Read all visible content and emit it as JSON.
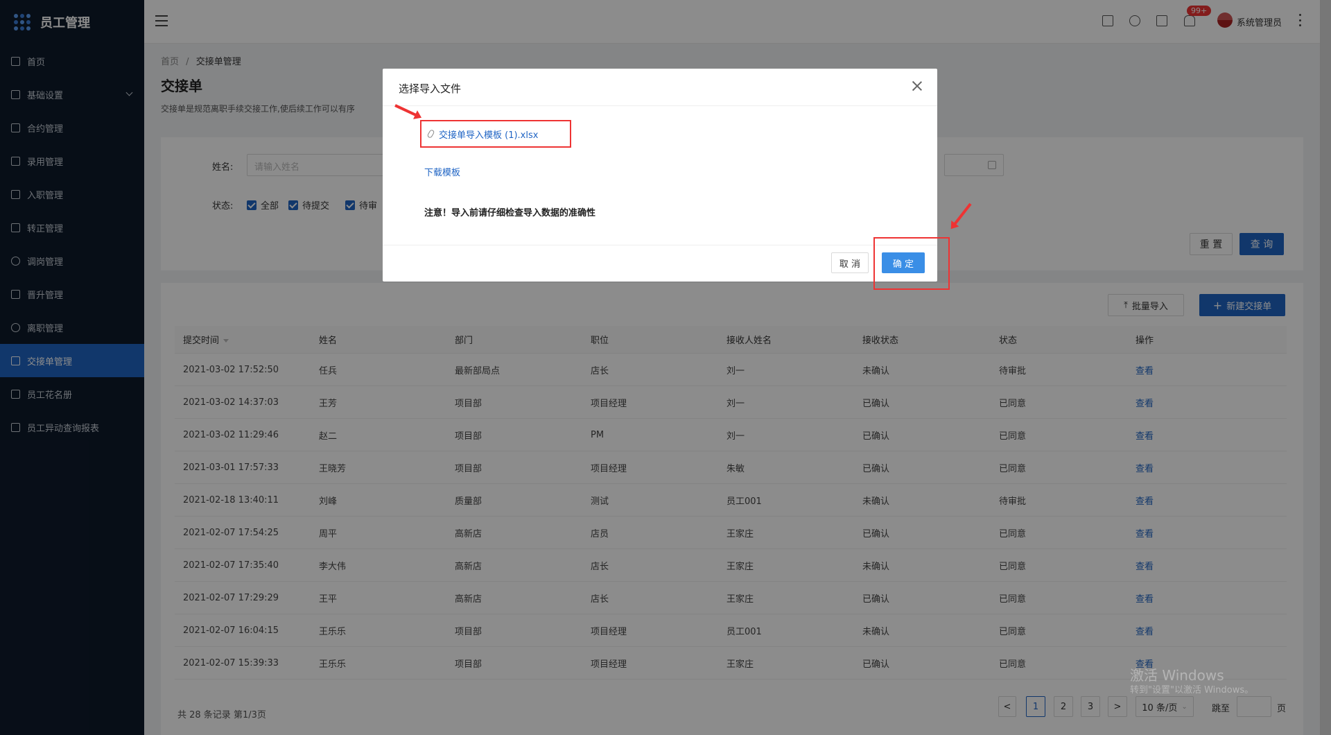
{
  "app": {
    "title": "员工管理"
  },
  "sidebar": {
    "items": [
      {
        "label": "首页"
      },
      {
        "label": "基础设置"
      },
      {
        "label": "合约管理"
      },
      {
        "label": "录用管理"
      },
      {
        "label": "入职管理"
      },
      {
        "label": "转正管理"
      },
      {
        "label": "调岗管理"
      },
      {
        "label": "晋升管理"
      },
      {
        "label": "离职管理"
      },
      {
        "label": "交接单管理"
      },
      {
        "label": "员工花名册"
      },
      {
        "label": "员工异动查询报表"
      }
    ]
  },
  "header": {
    "notification_badge": "99+",
    "username": "系统管理员"
  },
  "breadcrumb": {
    "home": "首页",
    "separator": "/",
    "current": "交接单管理"
  },
  "page": {
    "title": "交接单",
    "description": "交接单是规范离职手续交接工作,使后续工作可以有序"
  },
  "filter": {
    "name_label": "姓名:",
    "name_placeholder": "请输入姓名",
    "status_label": "状态:",
    "status_options": [
      "全部",
      "待提交",
      "待审"
    ],
    "reset_label": "重 置",
    "search_label": "查 询"
  },
  "toolbar": {
    "batch_import_label": "批量导入",
    "new_label": "新建交接单"
  },
  "table": {
    "headers": [
      "提交时间",
      "姓名",
      "部门",
      "职位",
      "接收人姓名",
      "接收状态",
      "状态",
      "操作"
    ],
    "rows": [
      [
        "2021-03-02 17:52:50",
        "任兵",
        "最新部局点",
        "店长",
        "刘一",
        "未确认",
        "待审批",
        "查看"
      ],
      [
        "2021-03-02 14:37:03",
        "王芳",
        "项目部",
        "项目经理",
        "刘一",
        "已确认",
        "已同意",
        "查看"
      ],
      [
        "2021-03-02 11:29:46",
        "赵二",
        "项目部",
        "PM",
        "刘一",
        "已确认",
        "已同意",
        "查看"
      ],
      [
        "2021-03-01 17:57:33",
        "王晓芳",
        "项目部",
        "项目经理",
        "朱敏",
        "已确认",
        "已同意",
        "查看"
      ],
      [
        "2021-02-18 13:40:11",
        "刘峰",
        "质量部",
        "测试",
        "员工001",
        "未确认",
        "待审批",
        "查看"
      ],
      [
        "2021-02-07 17:54:25",
        "周平",
        "高新店",
        "店员",
        "王家庄",
        "已确认",
        "已同意",
        "查看"
      ],
      [
        "2021-02-07 17:35:40",
        "李大伟",
        "高新店",
        "店长",
        "王家庄",
        "未确认",
        "已同意",
        "查看"
      ],
      [
        "2021-02-07 17:29:29",
        "王平",
        "高新店",
        "店长",
        "王家庄",
        "已确认",
        "已同意",
        "查看"
      ],
      [
        "2021-02-07 16:04:15",
        "王乐乐",
        "项目部",
        "项目经理",
        "员工001",
        "未确认",
        "已同意",
        "查看"
      ],
      [
        "2021-02-07 15:39:33",
        "王乐乐",
        "项目部",
        "项目经理",
        "王家庄",
        "已确认",
        "已同意",
        "查看"
      ]
    ]
  },
  "pagination": {
    "total": "共 28 条记录 第1/3页",
    "pages": [
      "1",
      "2",
      "3"
    ],
    "page_size": "10 条/页",
    "jump_label": "跳至",
    "page_suffix": "页",
    "prev": "<",
    "next": ">"
  },
  "modal": {
    "title": "选择导入文件",
    "file_name": "交接单导入模板 (1).xlsx",
    "download_label": "下载模板",
    "notice": "注意！导入前请仔细检查导入数据的准确性",
    "cancel_label": "取 消",
    "ok_label": "确 定"
  },
  "watermark": {
    "line1": "激活 Windows",
    "line2": "转到\"设置\"以激活 Windows。"
  },
  "colors": {
    "primary": "#1f64c4",
    "sidebar_bg": "#0e1a2b",
    "annotation": "#e33333"
  }
}
